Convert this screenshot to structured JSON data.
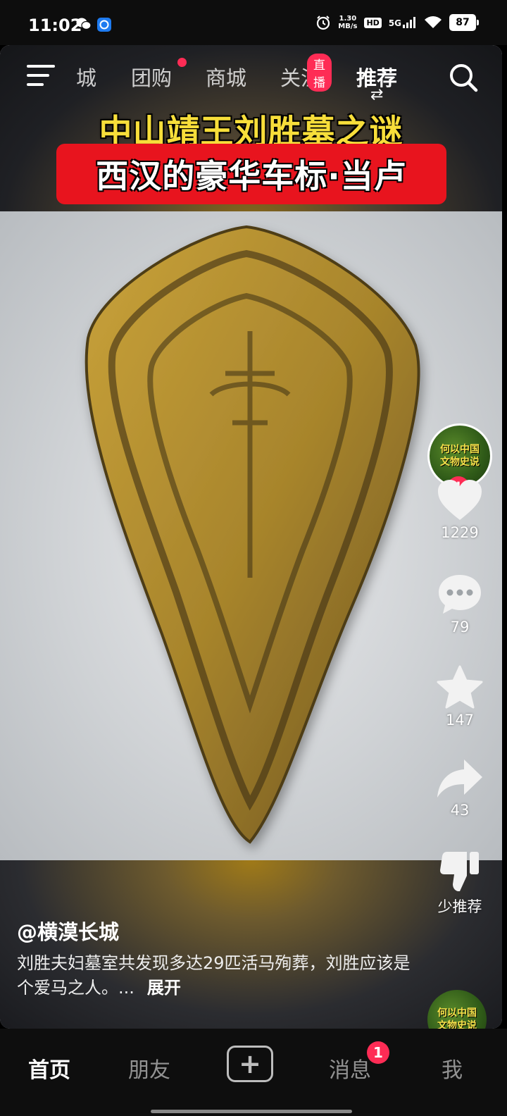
{
  "status_bar": {
    "time": "11:02",
    "icons": [
      "wechat-icon",
      "app-notification-icon",
      "alarm-icon",
      "hd-icon",
      "signal-icon",
      "wifi-icon"
    ],
    "net_speed_top": "1.30",
    "net_speed_bottom": "MB/s",
    "hd": "HD",
    "network": "5G",
    "battery": "87"
  },
  "top_nav": {
    "tabs": [
      {
        "label": "城"
      },
      {
        "label": "团购",
        "has_dot": true
      },
      {
        "label": "商城"
      },
      {
        "label": "关注",
        "badge": "直播"
      },
      {
        "label": "推荐",
        "active": true
      }
    ],
    "menu_icon": "menu-icon",
    "search_icon": "search-icon"
  },
  "video": {
    "title_line1": "中山靖王刘胜墓之谜",
    "title_line2": "西汉的豪华车标·当卢"
  },
  "right_rail": {
    "avatar_text_line1": "何以中国",
    "avatar_text_line2": "文物史说",
    "likes": "1229",
    "comments": "79",
    "favorites": "147",
    "shares": "43",
    "not_interested": "少推荐",
    "colors": {
      "accent": "#fe2c55"
    }
  },
  "caption": {
    "author": "@横漠长城",
    "text": "刘胜夫妇墓室共发现多达29匹活马殉葬，刘胜应该是个爱马之人。...",
    "expand": "展开"
  },
  "bottom_nav": {
    "items": [
      "首页",
      "朋友",
      "消息",
      "我"
    ],
    "message_badge": "1",
    "add_label": "+"
  }
}
